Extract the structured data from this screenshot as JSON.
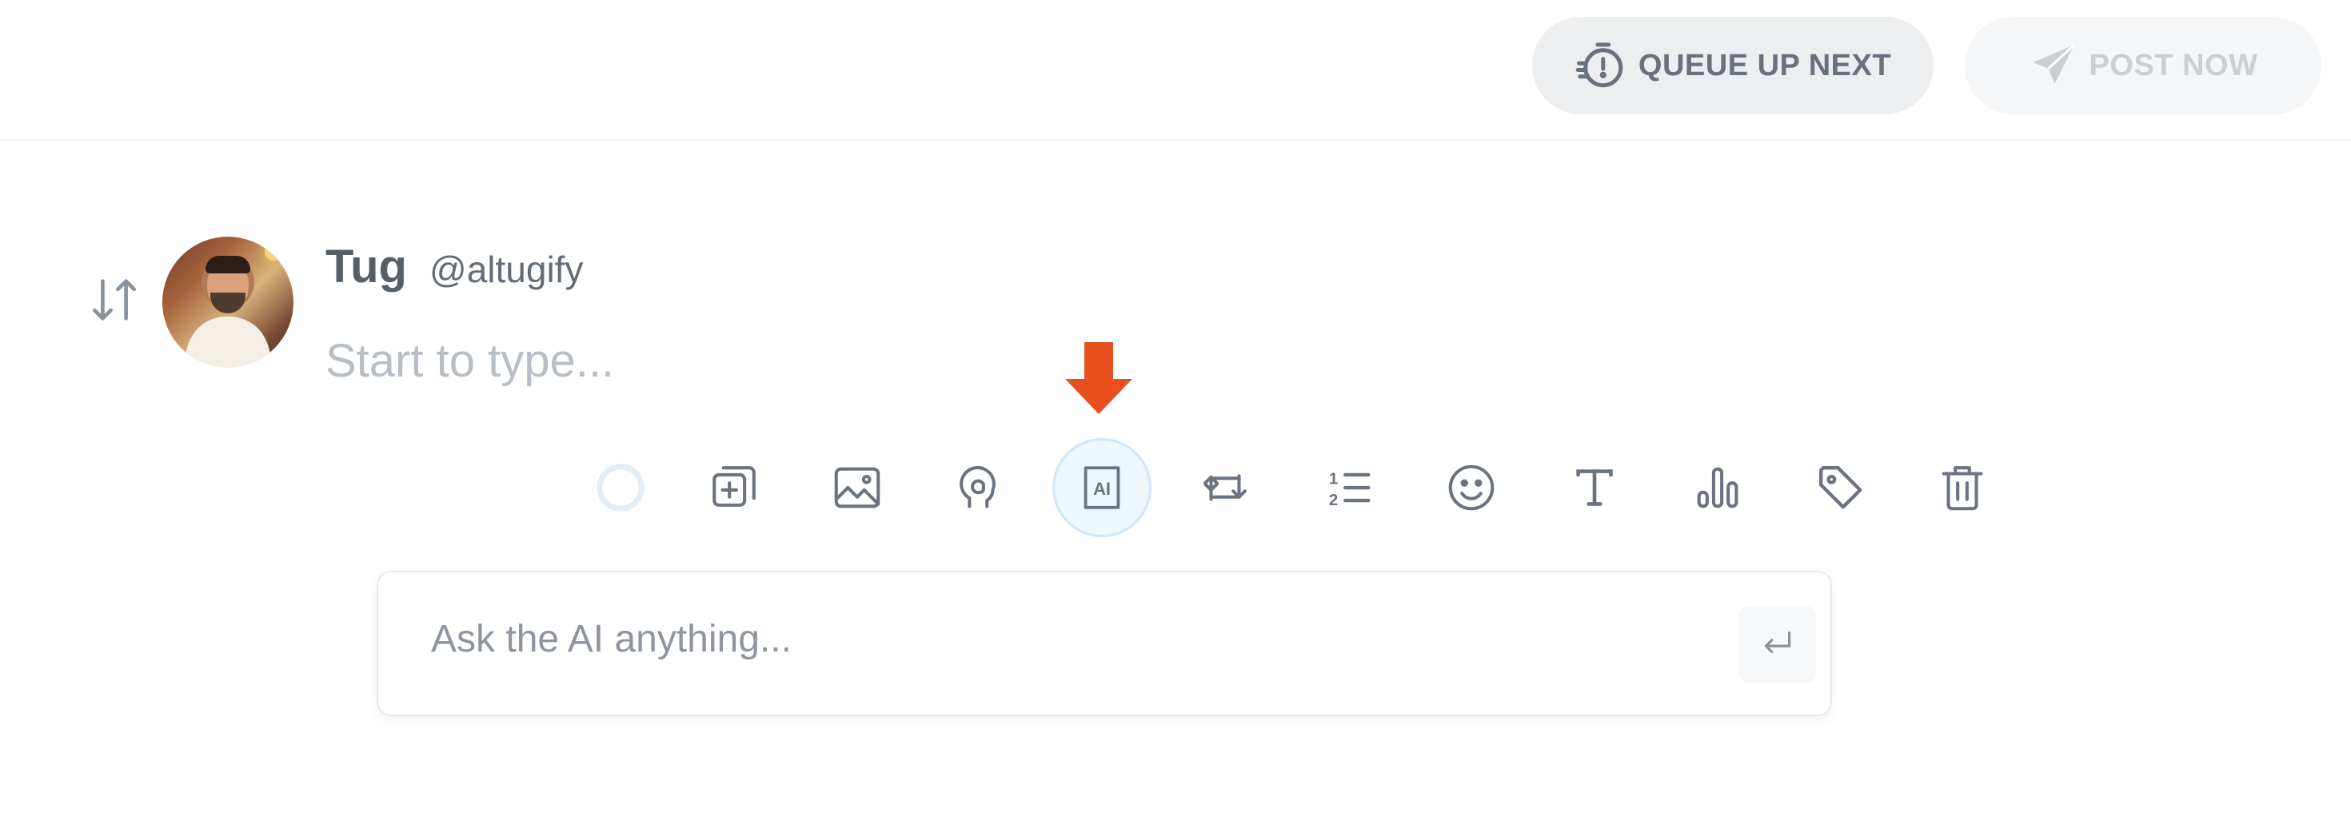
{
  "header": {
    "queue_label": "QUEUE UP NEXT",
    "post_label": "POST NOW"
  },
  "post": {
    "author_name": "Tug",
    "author_handle": "@altugify",
    "compose_placeholder": "Start to type..."
  },
  "toolbar": {
    "active_tool": "ai-icon",
    "icons": [
      "circle-progress-icon",
      "add-copy-icon",
      "image-icon",
      "gif-sticker-icon",
      "ai-icon",
      "retweet-icon",
      "numbered-list-icon",
      "emoji-icon",
      "text-format-icon",
      "poll-chart-icon",
      "tag-icon",
      "trash-icon"
    ]
  },
  "ai_prompt": {
    "placeholder": "Ask the AI anything...",
    "submit_icon": "enter-icon"
  },
  "colors": {
    "pointer_arrow": "#e8501f",
    "icon": "#6b7380",
    "active_bg": "#eef6fe"
  }
}
